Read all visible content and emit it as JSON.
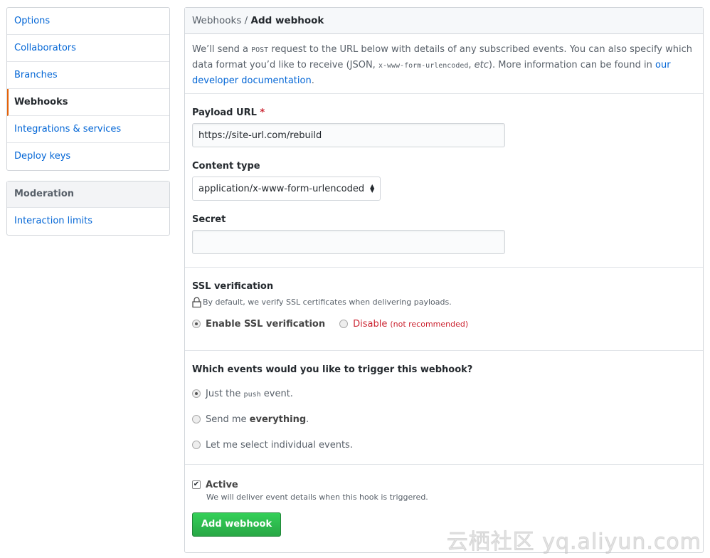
{
  "sidebar": {
    "items": [
      {
        "label": "Options"
      },
      {
        "label": "Collaborators"
      },
      {
        "label": "Branches"
      },
      {
        "label": "Webhooks",
        "selected": true
      },
      {
        "label": "Integrations & services"
      },
      {
        "label": "Deploy keys"
      }
    ],
    "moderation": {
      "heading": "Moderation",
      "items": [
        {
          "label": "Interaction limits"
        }
      ]
    }
  },
  "header": {
    "breadcrumb_parent": "Webhooks",
    "separator": " / ",
    "title": "Add webhook"
  },
  "intro": {
    "t1": "We’ll send a ",
    "code1": "POST",
    "t2": " request to the URL below with details of any subscribed events. You can also specify which data format you’d like to receive (JSON, ",
    "code2": "x-www-form-urlencoded",
    "t3": ", ",
    "etc": "etc",
    "t4": "). More information can be found in ",
    "link": "our developer documentation",
    "t5": "."
  },
  "form": {
    "payload_label": "Payload URL",
    "required_mark": "*",
    "payload_value": "https://site-url.com/rebuild",
    "content_type_label": "Content type",
    "content_type_value": "application/x-www-form-urlencoded",
    "secret_label": "Secret",
    "secret_value": ""
  },
  "ssl": {
    "heading": "SSL verification",
    "note": "By default, we verify SSL certificates when delivering payloads.",
    "enable_label": "Enable SSL verification",
    "disable_label": "Disable",
    "disable_note": "(not recommended)",
    "selected": "enable"
  },
  "events": {
    "heading": "Which events would you like to trigger this webhook?",
    "opt1_a": "Just the ",
    "opt1_code": "push",
    "opt1_b": " event.",
    "opt2_a": "Send me ",
    "opt2_b": "everything",
    "opt2_c": ".",
    "opt3": "Let me select individual events.",
    "selected": "push"
  },
  "active": {
    "label": "Active",
    "checked": true,
    "note": "We will deliver event details when this hook is triggered."
  },
  "submit_label": "Add webhook",
  "watermark": "云栖社区 yq.aliyun.com",
  "colors": {
    "accent": "#e36209",
    "link": "#0366d6",
    "button": "#28a745",
    "danger": "#cb2431"
  }
}
